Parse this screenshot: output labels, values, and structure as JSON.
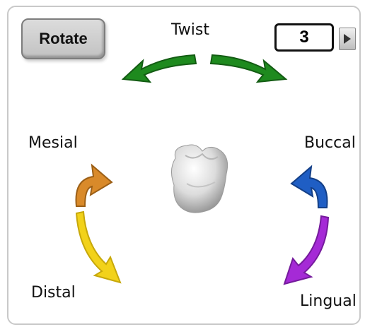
{
  "controls": {
    "rotate_label": "Rotate",
    "twist_label": "Twist",
    "count_value": "3"
  },
  "directions": {
    "mesial": "Mesial",
    "buccal": "Buccal",
    "distal": "Distal",
    "lingual": "Lingual"
  },
  "colors": {
    "twist_arrows": "#1e8a1e",
    "mesial_arrow": "#d98a2a",
    "buccal_arrow": "#1f5ec4",
    "distal_arrow": "#f2d21a",
    "lingual_arrow": "#a52ad6"
  }
}
